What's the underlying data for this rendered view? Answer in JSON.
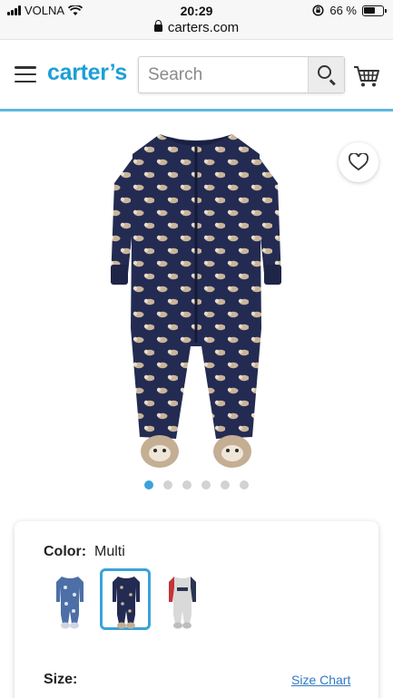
{
  "status_bar": {
    "carrier": "VOLNA",
    "time": "20:29",
    "battery_percent": "66 %",
    "battery_level": 0.66
  },
  "browser": {
    "url": "carters.com"
  },
  "header": {
    "logo_text": "carter’s",
    "search_placeholder": "Search",
    "brand_color": "#1c9fd8"
  },
  "product": {
    "image_alt": "Navy sloth print footed zip-up sleeper",
    "carousel": {
      "total": 6,
      "active_index": 0
    }
  },
  "options": {
    "color_label": "Color:",
    "color_value": "Multi",
    "swatches": [
      {
        "name": "blue-print",
        "selected": false
      },
      {
        "name": "navy-sloth",
        "selected": true
      },
      {
        "name": "gray-red",
        "selected": false
      }
    ],
    "size_label": "Size:",
    "size_chart_link": "Size Chart"
  },
  "icons": {
    "menu": "hamburger-menu-icon",
    "search": "search-icon",
    "cart": "cart-icon",
    "wishlist": "heart-icon"
  }
}
